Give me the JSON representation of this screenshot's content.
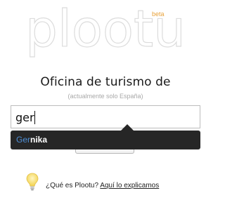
{
  "logo": {
    "text": "plootu",
    "badge": "beta"
  },
  "headline": "Oficina de turismo de",
  "subnote": "(actualmente solo España)",
  "search": {
    "value": "ger"
  },
  "suggestions": [
    {
      "match": "Ger",
      "rest": "nika"
    }
  ],
  "help": {
    "question": "¿Qué es Plootu?",
    "link": "Aquí lo explicamos"
  },
  "colors": {
    "beta": "#e8a23a",
    "suggestion_bg": "#262626",
    "suggestion_match": "#4f8fd6",
    "bulb": "#f9e27a"
  }
}
